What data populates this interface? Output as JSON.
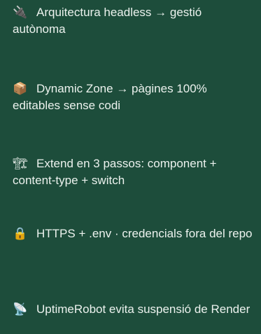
{
  "features": [
    {
      "icon": "plug-icon",
      "glyph": "🔌",
      "text": "Arquitectura headless → gestió autònoma"
    },
    {
      "icon": "package-icon",
      "glyph": "📦",
      "text": "Dynamic Zone → pàgines 100% editables sense codi"
    },
    {
      "icon": "construction-crane-icon",
      "glyph": "🏗",
      "text": "Extend en 3 passos: component + content-type + switch"
    },
    {
      "icon": "lock-icon",
      "glyph": "🔒",
      "text": "HTTPS + .env · credencials fora del repo"
    },
    {
      "icon": "satellite-antenna-icon",
      "glyph": "📡",
      "text": "UptimeRobot evita suspensió de Render"
    }
  ],
  "colors": {
    "background": "#1d4d3b",
    "text": "#ecf2ee"
  }
}
